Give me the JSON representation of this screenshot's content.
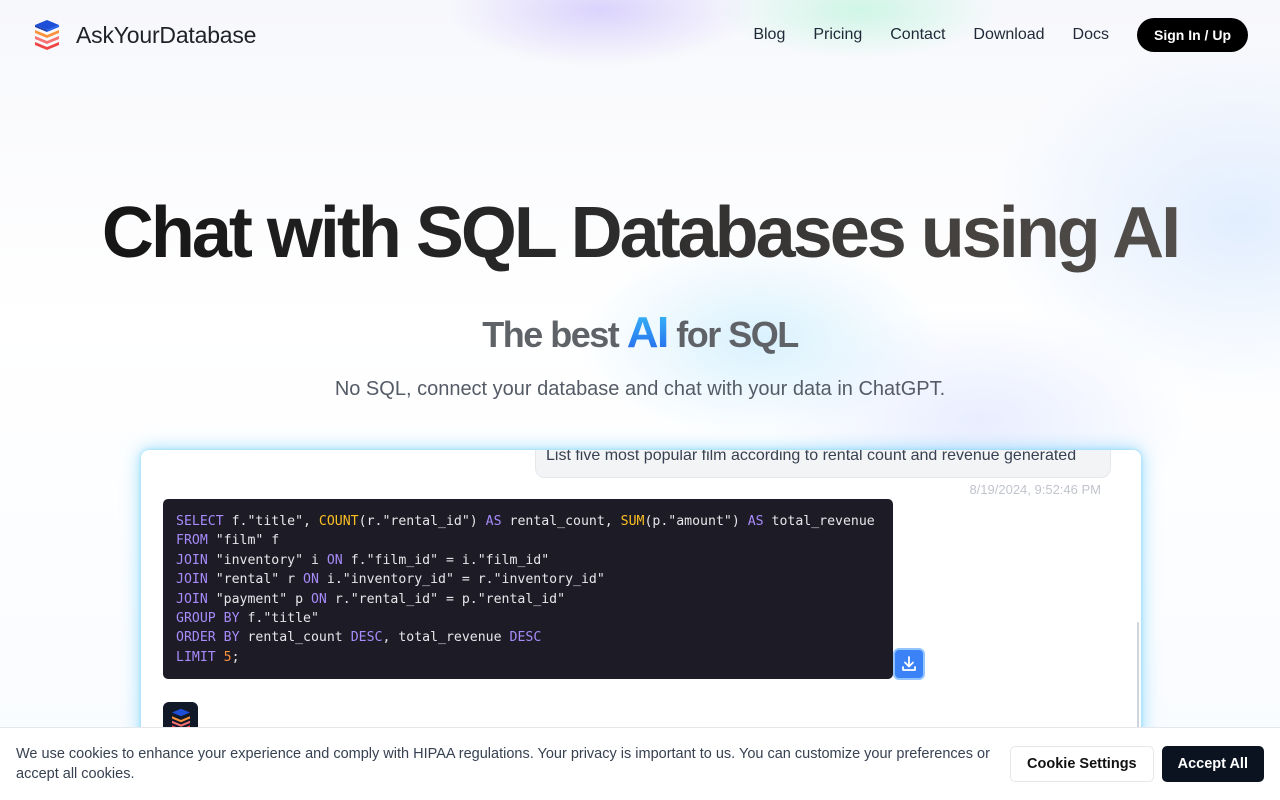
{
  "brand": {
    "name": "AskYourDatabase"
  },
  "nav": {
    "items": [
      "Blog",
      "Pricing",
      "Contact",
      "Download",
      "Docs"
    ],
    "signin_label": "Sign In / Up"
  },
  "hero": {
    "title": "Chat with SQL Databases using AI",
    "subtitle_prefix": "The best",
    "subtitle_highlight": "AI",
    "subtitle_suffix": "for SQL",
    "tagline": "No SQL, connect your database and chat with your data in ChatGPT."
  },
  "demo": {
    "user_message": "List five most popular film according to rental count and revenue generated",
    "timestamp": "8/19/2024, 9:52:46 PM",
    "sql_lines": [
      "SELECT f.\"title\", COUNT(r.\"rental_id\") AS rental_count, SUM(p.\"amount\") AS total_revenue",
      "FROM \"film\" f",
      "JOIN \"inventory\" i ON f.\"film_id\" = i.\"film_id\"",
      "JOIN \"rental\" r ON i.\"inventory_id\" = r.\"inventory_id\"",
      "JOIN \"payment\" p ON r.\"rental_id\" = p.\"rental_id\"",
      "GROUP BY f.\"title\"",
      "ORDER BY rental_count DESC, total_revenue DESC",
      "LIMIT 5;"
    ]
  },
  "cookie": {
    "text": "We use cookies to enhance your experience and comply with HIPAA regulations. Your privacy is important to us. You can customize your preferences or accept all cookies.",
    "settings_label": "Cookie Settings",
    "accept_label": "Accept All"
  },
  "colors": {
    "accent": "#3b82f6",
    "code_bg": "#1c1b26",
    "keyword": "#a78bfa",
    "function": "#fbbf24"
  },
  "icons": {
    "logo": "stacked-database-icon",
    "download": "download-icon"
  }
}
